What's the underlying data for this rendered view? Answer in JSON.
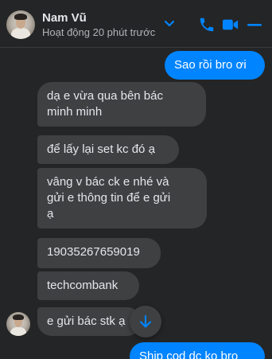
{
  "header": {
    "contact_name": "Nam Vũ",
    "status": "Hoạt động 20 phút trước",
    "accent_color": "#0084ff",
    "icons": [
      "chevron-down-icon",
      "phone-icon",
      "video-camera-icon",
      "minimize-icon"
    ]
  },
  "messages": [
    {
      "direction": "outgoing",
      "text": "Sao rồi bro ơi"
    },
    {
      "direction": "incoming",
      "lines": [
        "dạ e vừa qua bên bác",
        "minh minh"
      ]
    },
    {
      "direction": "incoming",
      "text": "để lấy lại set kc đó ạ"
    },
    {
      "direction": "incoming",
      "lines": [
        "vâng v bác ck e nhé và",
        "gửi e thông tin để e gửi",
        "ạ"
      ]
    },
    {
      "direction": "incoming",
      "text": "19035267659019"
    },
    {
      "direction": "incoming",
      "text": "techcombank"
    },
    {
      "direction": "incoming",
      "text": "e gửi bác stk ạ"
    },
    {
      "direction": "outgoing",
      "text": "Ship cod dc ko bro"
    }
  ],
  "scroll_button": {
    "icon": "arrow-down-icon"
  }
}
